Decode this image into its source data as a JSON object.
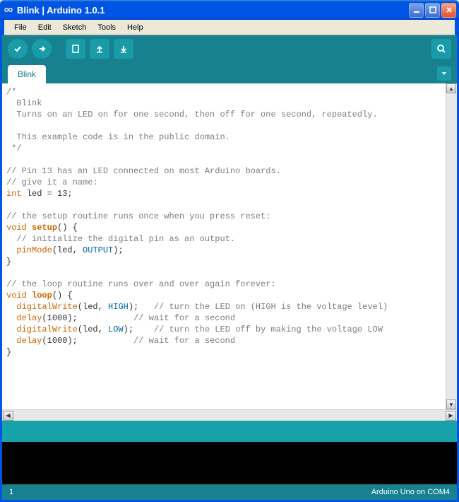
{
  "window": {
    "title": "Blink | Arduino 1.0.1"
  },
  "menu": {
    "file": "File",
    "edit": "Edit",
    "sketch": "Sketch",
    "tools": "Tools",
    "help": "Help"
  },
  "tab": {
    "name": "Blink"
  },
  "status": {
    "line": "1",
    "board": "Arduino Uno on COM4"
  },
  "code": {
    "c1": "/*",
    "c2": "  Blink",
    "c3": "  Turns on an LED on for one second, then off for one second, repeatedly.",
    "c4": " ",
    "c5": "  This example code is in the public domain.",
    "c6": " */",
    "c7": "",
    "c8": "// Pin 13 has an LED connected on most Arduino boards.",
    "c9": "// give it a name:",
    "l10_kw": "int",
    "l10_rest": " led = 13;",
    "c11": "",
    "c12": "// the setup routine runs once when you press reset:",
    "l13_kw": "void",
    "l13_fn": "setup",
    "l13_rest": "() {",
    "c14": "  // initialize the digital pin as an output.",
    "l15_pad": "  ",
    "l15_fn": "pinMode",
    "l15_a": "(led, ",
    "l15_const": "OUTPUT",
    "l15_b": ");",
    "l16": "}",
    "c17": "",
    "c18": "// the loop routine runs over and over again forever:",
    "l19_kw": "void",
    "l19_fn": "loop",
    "l19_rest": "() {",
    "l20_pad": "  ",
    "l20_fn": "digitalWrite",
    "l20_a": "(led, ",
    "l20_const": "HIGH",
    "l20_b": ");   ",
    "l20_cmt": "// turn the LED on (HIGH is the voltage level)",
    "l21_pad": "  ",
    "l21_fn": "delay",
    "l21_a": "(1000);           ",
    "l21_cmt": "// wait for a second",
    "l22_pad": "  ",
    "l22_fn": "digitalWrite",
    "l22_a": "(led, ",
    "l22_const": "LOW",
    "l22_b": ");    ",
    "l22_cmt": "// turn the LED off by making the voltage LOW",
    "l23_pad": "  ",
    "l23_fn": "delay",
    "l23_a": "(1000);           ",
    "l23_cmt": "// wait for a second",
    "l24": "}"
  }
}
